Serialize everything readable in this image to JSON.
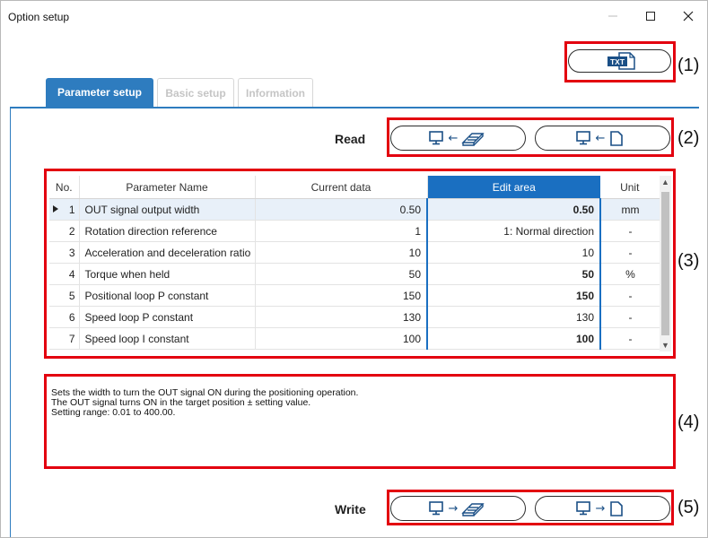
{
  "window": {
    "title": "Option setup",
    "minimize_glyph": "—",
    "maximize_glyph": "☐",
    "close_glyph": "✕"
  },
  "toolbar": {
    "txt_icon_label": "TXT"
  },
  "tabs": [
    {
      "label": "Parameter setup",
      "active": true
    },
    {
      "label": "Basic setup",
      "active": false
    },
    {
      "label": "Information",
      "active": false
    }
  ],
  "read": {
    "label": "Read"
  },
  "write": {
    "label": "Write"
  },
  "callouts": [
    "(1)",
    "(2)",
    "(3)",
    "(4)",
    "(5)"
  ],
  "table": {
    "headers": [
      "No.",
      "Parameter Name",
      "Current data",
      "Edit area",
      "Unit"
    ],
    "rows": [
      {
        "no": "1",
        "name": "OUT signal output width",
        "current": "0.50",
        "edit": "0.50",
        "unit": "mm"
      },
      {
        "no": "2",
        "name": "Rotation direction reference",
        "current": "1",
        "edit": "1: Normal direction",
        "unit": "-"
      },
      {
        "no": "3",
        "name": "Acceleration and deceleration ratio",
        "current": "10",
        "edit": "10",
        "unit": "-"
      },
      {
        "no": "4",
        "name": "Torque when held",
        "current": "50",
        "edit": "50",
        "unit": "%"
      },
      {
        "no": "5",
        "name": "Positional loop P constant",
        "current": "150",
        "edit": "150",
        "unit": "-"
      },
      {
        "no": "6",
        "name": "Speed loop P constant",
        "current": "130",
        "edit": "130",
        "unit": "-"
      },
      {
        "no": "7",
        "name": "Speed loop I constant",
        "current": "100",
        "edit": "100",
        "unit": "-"
      }
    ]
  },
  "description": {
    "line1": "Sets the width to turn the OUT signal ON during the positioning operation.",
    "line2": "The OUT signal turns ON in the target position ± setting value.",
    "line3": "Setting range: 0.01 to 400.00."
  },
  "icons": {
    "pc": "monitor-icon",
    "driver": "driver-device-icon",
    "file": "file-icon",
    "arrow_left": "←",
    "arrow_right": "→"
  },
  "colors": {
    "accent": "#2e7cbf",
    "edit_header": "#1a6fc1",
    "highlight_box": "#e3000f"
  }
}
